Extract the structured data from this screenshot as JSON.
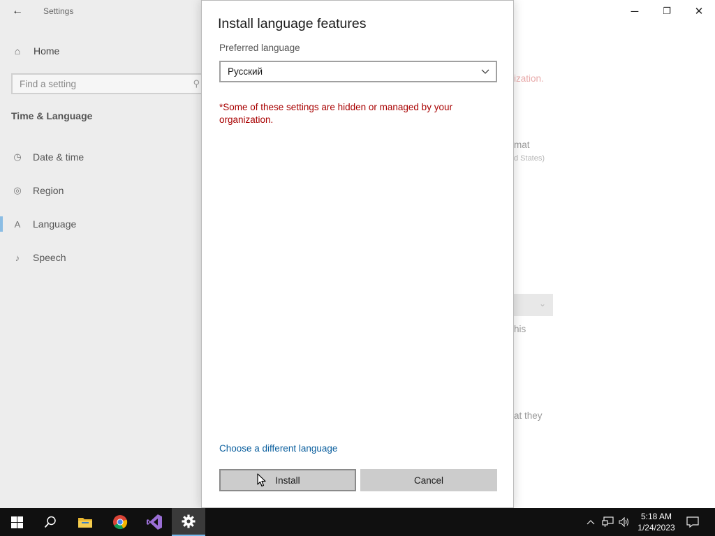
{
  "window": {
    "title": "Settings",
    "back_glyph": "←",
    "minimize_glyph": "─",
    "restore_glyph": "❐",
    "close_glyph": "✕"
  },
  "sidebar": {
    "home_label": "Home",
    "home_icon": "home-icon",
    "search_placeholder": "Find a setting",
    "section_title": "Time & Language",
    "items": [
      {
        "label": "Date & time",
        "icon": "clock-icon"
      },
      {
        "label": "Region",
        "icon": "globe-icon"
      },
      {
        "label": "Language",
        "icon": "language-icon"
      },
      {
        "label": "Speech",
        "icon": "microphone-icon"
      }
    ],
    "active_item": "Language",
    "accent_color": "#3a96dd"
  },
  "background_pane": {
    "fragments": [
      "ization.",
      "mat",
      "d States)",
      "his",
      "at they"
    ]
  },
  "dialog": {
    "title": "Install language features",
    "preferred_language_label": "Preferred language",
    "selected_language": "Русский",
    "warning": "*Some of these settings are hidden or managed by your organization.",
    "warning_color": "#a80000",
    "link_label": "Choose a different language",
    "install_label": "Install",
    "cancel_label": "Cancel"
  },
  "taskbar": {
    "apps": [
      {
        "name": "start-button",
        "icon": "windows-logo-icon"
      },
      {
        "name": "search-button",
        "icon": "search-icon"
      },
      {
        "name": "file-explorer-button",
        "icon": "folder-icon"
      },
      {
        "name": "chrome-button",
        "icon": "chrome-icon"
      },
      {
        "name": "visual-studio-button",
        "icon": "visual-studio-icon"
      },
      {
        "name": "settings-button",
        "icon": "gear-icon",
        "active": true
      }
    ],
    "tray_chevron": "∧",
    "clock_time": "5:18 AM",
    "clock_date": "1/24/2023"
  }
}
